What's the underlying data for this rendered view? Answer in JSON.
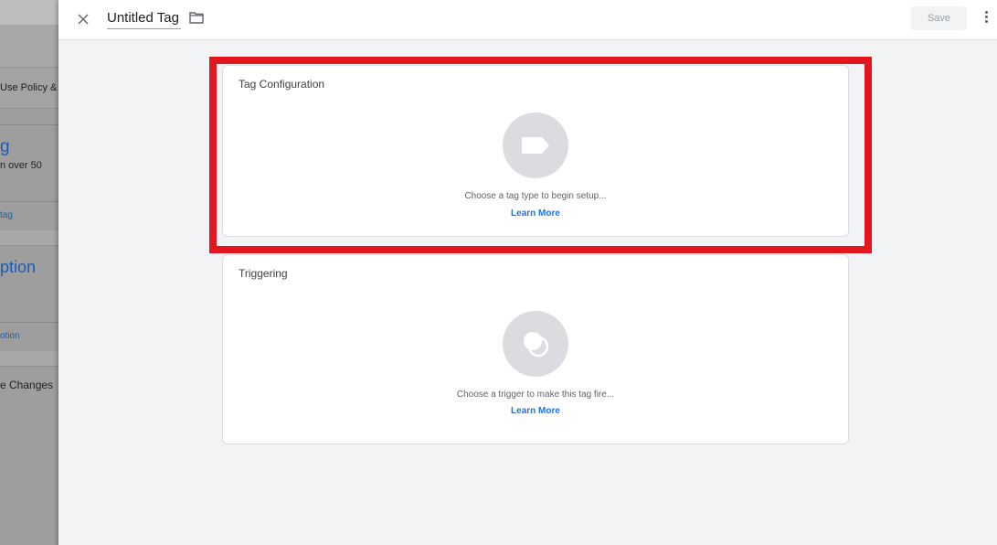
{
  "background_page": {
    "items": [
      {
        "text": "Use Policy & T"
      },
      {
        "text": "g"
      },
      {
        "text": "n over 50"
      },
      {
        "text": "tag"
      },
      {
        "text": "ption"
      },
      {
        "text": "otion"
      },
      {
        "text": "e Changes"
      }
    ]
  },
  "header": {
    "tag_name": "Untitled Tag",
    "save_label": "Save",
    "icons": {
      "close": "close-icon",
      "folder": "folder-icon",
      "more": "more-vert-icon"
    }
  },
  "tag_configuration": {
    "title": "Tag Configuration",
    "hint": "Choose a tag type to begin setup...",
    "link": "Learn More",
    "icon": "tag-icon"
  },
  "triggering": {
    "title": "Triggering",
    "hint": "Choose a trigger to make this tag fire...",
    "link": "Learn More",
    "icon": "trigger-icon"
  },
  "colors": {
    "highlight": "#e3151f",
    "link": "#1a73e8",
    "circle": "#dadce0"
  }
}
